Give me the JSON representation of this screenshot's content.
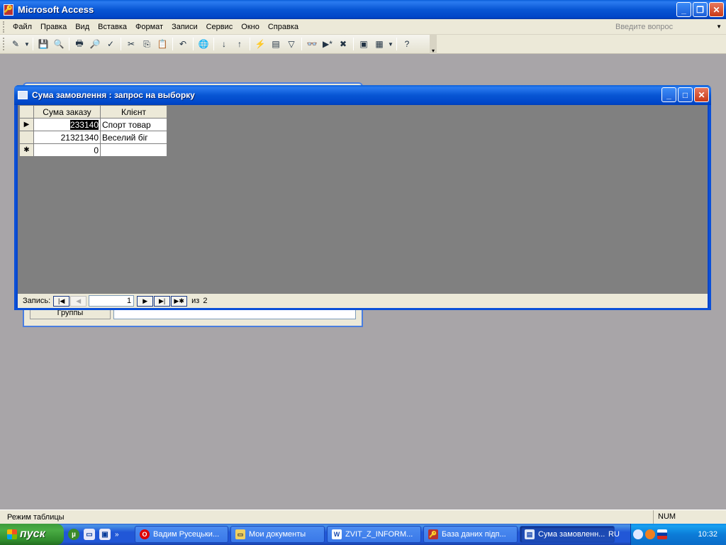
{
  "app": {
    "title": "Microsoft Access"
  },
  "menu": {
    "items": [
      "Файл",
      "Правка",
      "Вид",
      "Вставка",
      "Формат",
      "Записи",
      "Сервис",
      "Окно",
      "Справка"
    ],
    "help_placeholder": "Введите вопрос"
  },
  "background_form": {
    "label": "Группы"
  },
  "query_window": {
    "title": "Сума замовлення : запрос на выборку",
    "columns": [
      "Сума заказу",
      "Клієнт"
    ],
    "rows": [
      {
        "sum": "233140",
        "client": "Спорт товар"
      },
      {
        "sum": "21321340",
        "client": "Веселий біг"
      }
    ],
    "new_row": {
      "sum": "0",
      "client": ""
    },
    "nav": {
      "label": "Запись:",
      "current": "1",
      "of": "из",
      "total": "2"
    }
  },
  "status": {
    "mode": "Режим таблицы",
    "num": "NUM"
  },
  "taskbar": {
    "start": "пуск",
    "tasks": [
      "Вадим Русецьки...",
      "Мои документы",
      "ZVIT_Z_INFORM...",
      "База даних підп...",
      "Сума замовленн..."
    ],
    "language": "RU",
    "clock": "10:32"
  },
  "colors": {
    "xp_blue": "#0856d4",
    "workspace": "#a8a5a8",
    "grid_body": "#808080"
  }
}
